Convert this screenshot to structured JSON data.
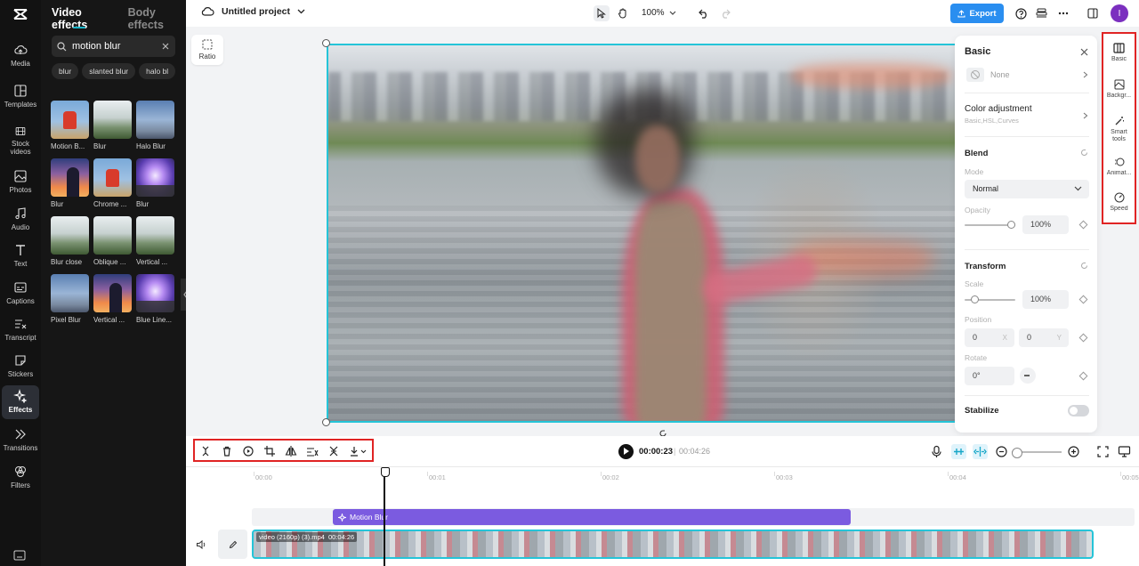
{
  "rail": {
    "items": [
      {
        "label": "Media",
        "icon": "cloud-upload-icon"
      },
      {
        "label": "Templates",
        "icon": "templates-icon"
      },
      {
        "label": "Stock videos",
        "icon": "film-icon"
      },
      {
        "label": "Photos",
        "icon": "image-icon"
      },
      {
        "label": "Audio",
        "icon": "music-icon"
      },
      {
        "label": "Text",
        "icon": "text-icon"
      },
      {
        "label": "Captions",
        "icon": "captions-icon"
      },
      {
        "label": "Transcript",
        "icon": "transcript-icon"
      },
      {
        "label": "Stickers",
        "icon": "sticker-icon"
      },
      {
        "label": "Effects",
        "icon": "sparkle-icon"
      },
      {
        "label": "Transitions",
        "icon": "transition-icon"
      },
      {
        "label": "Filters",
        "icon": "filter-icon"
      }
    ],
    "active": "Effects"
  },
  "panel": {
    "tabs": [
      "Video effects",
      "Body effects"
    ],
    "search_value": "motion blur",
    "chips": [
      "blur",
      "slanted blur",
      "halo bl"
    ],
    "effects": [
      {
        "caption": "Motion B...",
        "thumb": "rider"
      },
      {
        "caption": "Blur",
        "thumb": "field"
      },
      {
        "caption": "Halo Blur",
        "thumb": "city"
      },
      {
        "caption": "Blur",
        "thumb": "silo"
      },
      {
        "caption": "Chrome ...",
        "thumb": "rider"
      },
      {
        "caption": "Blur",
        "thumb": "purple"
      },
      {
        "caption": "Blur close",
        "thumb": "field"
      },
      {
        "caption": "Oblique ...",
        "thumb": "field"
      },
      {
        "caption": "Vertical ...",
        "thumb": "field"
      },
      {
        "caption": "Pixel Blur",
        "thumb": "city"
      },
      {
        "caption": "Vertical ...",
        "thumb": "silo"
      },
      {
        "caption": "Blue Line...",
        "thumb": "purple"
      }
    ]
  },
  "topbar": {
    "project_title": "Untitled project",
    "zoom": "100%",
    "export_label": "Export",
    "avatar_initial": "I"
  },
  "canvas": {
    "ratio_label": "Ratio"
  },
  "props": {
    "title": "Basic",
    "none_label": "None",
    "color_adjustment": {
      "label": "Color adjustment",
      "sub": "Basic,HSL,Curves"
    },
    "blend": {
      "label": "Blend",
      "mode_label": "Mode",
      "mode_value": "Normal",
      "opacity_label": "Opacity",
      "opacity_value": "100%",
      "opacity_fraction": 1.0
    },
    "transform": {
      "label": "Transform",
      "scale_label": "Scale",
      "scale_value": "100%",
      "position_label": "Position",
      "pos_x": "0",
      "pos_y": "0",
      "x_axis": "X",
      "y_axis": "Y",
      "rotate_label": "Rotate",
      "rotate_value": "0°"
    },
    "stabilize_label": "Stabilize"
  },
  "toolrail": {
    "items": [
      {
        "label": "Basic",
        "icon": "basic-icon"
      },
      {
        "label": "Backgr...",
        "icon": "background-icon"
      },
      {
        "label": "Smart tools",
        "icon": "magic-wand-icon"
      },
      {
        "label": "Animat...",
        "icon": "animation-icon"
      },
      {
        "label": "Speed",
        "icon": "speed-icon"
      }
    ]
  },
  "playback": {
    "current": "00:00:23",
    "separator": "|",
    "total": "00:04:26"
  },
  "timeline": {
    "ticks": [
      "00:00",
      "00:01",
      "00:02",
      "00:03",
      "00:04",
      "00:05"
    ],
    "effect_clip": "Motion Blur",
    "video_clip": "video (2160p) (3).mp4",
    "video_duration": "00:04:26"
  },
  "colors": {
    "accent": "#25c4d8",
    "export": "#2a8ef0",
    "effect_clip": "#7b5be0",
    "highlight": "#e02424",
    "avatar": "#7b2fbf"
  }
}
